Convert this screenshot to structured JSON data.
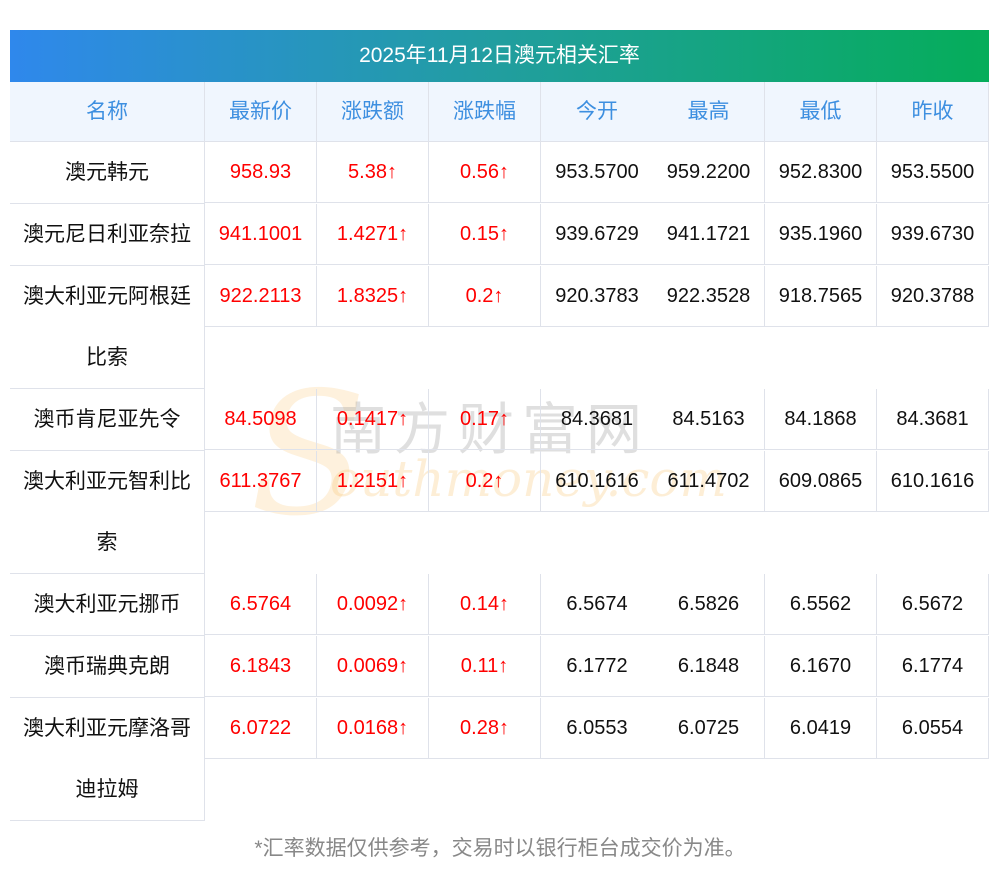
{
  "title": "2025年11月12日澳元相关汇率",
  "headers": [
    "名称",
    "最新价",
    "涨跌额",
    "涨跌幅",
    "今开",
    "最高",
    "最低",
    "昨收"
  ],
  "rows": [
    {
      "name": "澳元韩元",
      "price": "958.93",
      "change": "5.38↑",
      "pct": "0.56↑",
      "open": "953.5700",
      "high": "959.2200",
      "low": "952.8300",
      "prev": "953.5500"
    },
    {
      "name": "澳元尼日利亚奈拉",
      "price": "941.1001",
      "change": "1.4271↑",
      "pct": "0.15↑",
      "open": "939.6729",
      "high": "941.1721",
      "low": "935.1960",
      "prev": "939.6730"
    },
    {
      "name": "澳大利亚元阿根廷比索",
      "price": "922.2113",
      "change": "1.8325↑",
      "pct": "0.2↑",
      "open": "920.3783",
      "high": "922.3528",
      "low": "918.7565",
      "prev": "920.3788"
    },
    {
      "name": "澳币肯尼亚先令",
      "price": "84.5098",
      "change": "0.1417↑",
      "pct": "0.17↑",
      "open": "84.3681",
      "high": "84.5163",
      "low": "84.1868",
      "prev": "84.3681"
    },
    {
      "name": "澳大利亚元智利比索",
      "price": "611.3767",
      "change": "1.2151↑",
      "pct": "0.2↑",
      "open": "610.1616",
      "high": "611.4702",
      "low": "609.0865",
      "prev": "610.1616"
    },
    {
      "name": "澳大利亚元挪币",
      "price": "6.5764",
      "change": "0.0092↑",
      "pct": "0.14↑",
      "open": "6.5674",
      "high": "6.5826",
      "low": "6.5562",
      "prev": "6.5672"
    },
    {
      "name": "澳币瑞典克朗",
      "price": "6.1843",
      "change": "0.0069↑",
      "pct": "0.11↑",
      "open": "6.1772",
      "high": "6.1848",
      "low": "6.1670",
      "prev": "6.1774"
    },
    {
      "name": "澳大利亚元摩洛哥迪拉姆",
      "price": "6.0722",
      "change": "0.0168↑",
      "pct": "0.28↑",
      "open": "6.0553",
      "high": "6.0725",
      "low": "6.0419",
      "prev": "6.0554"
    }
  ],
  "footnote": "*汇率数据仅供参考，交易时以银行柜台成交价为准。",
  "watermark": {
    "cn": "南方财富网",
    "en": "Southmoney.com"
  },
  "colors": {
    "up": "#ff0000",
    "header_text": "#3d8fe0"
  }
}
